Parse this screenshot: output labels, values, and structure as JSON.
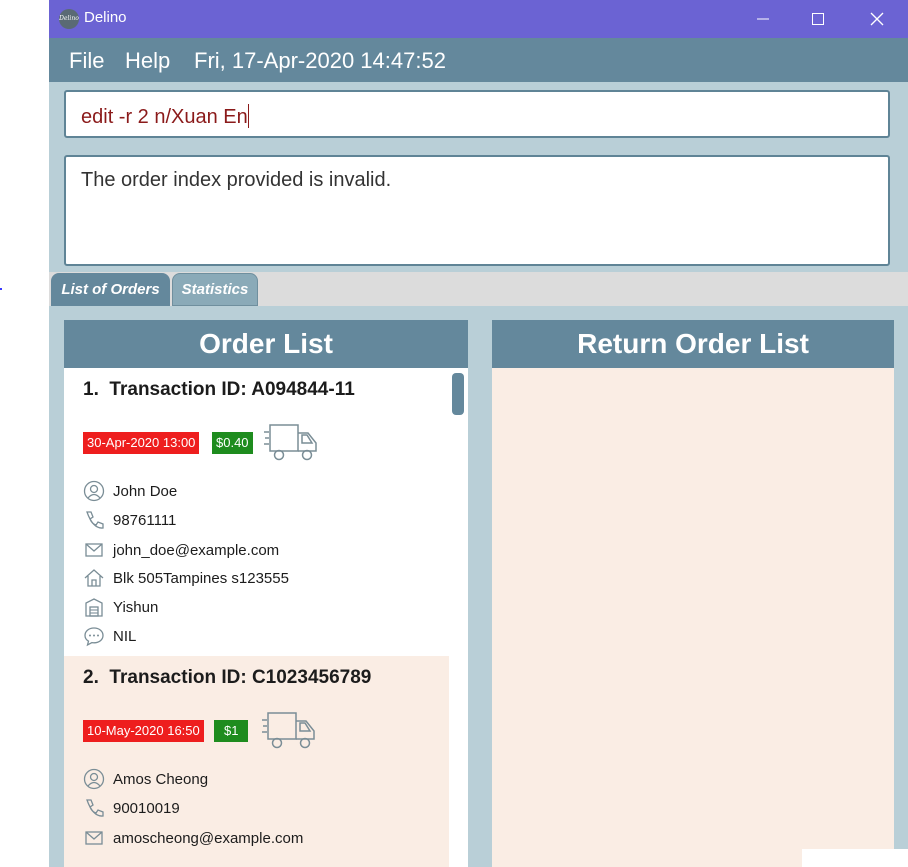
{
  "window": {
    "title": "Delino",
    "icon_text": "Delino"
  },
  "menu": {
    "file": "File",
    "help": "Help",
    "datetime": "Fri, 17-Apr-2020 14:47:52"
  },
  "command": {
    "value": "edit -r 2 n/Xuan En"
  },
  "result": {
    "message": "The order index provided is invalid."
  },
  "tabs": [
    {
      "label": "List of Orders",
      "selected": true
    },
    {
      "label": "Statistics",
      "selected": false
    }
  ],
  "order_panel": {
    "title": "Order List"
  },
  "return_panel": {
    "title": "Return Order List"
  },
  "orders": [
    {
      "index": "1.",
      "transaction": "Transaction ID: A094844-11",
      "date": "30-Apr-2020 13:00",
      "cash": "$0.40",
      "name": "John Doe",
      "phone": "98761111",
      "email": "john_doe@example.com",
      "address": "Blk 505Tampines  s123555",
      "warehouse": "Yishun",
      "comment": "NIL"
    },
    {
      "index": "2.",
      "transaction": "Transaction ID: C1023456789",
      "date": "10-May-2020 16:50",
      "cash": "$1",
      "name": "Amos Cheong",
      "phone": "90010019",
      "email": "amoscheong@example.com"
    }
  ],
  "colors": {
    "titlebar": "#6b63d3",
    "menubar": "#64889c",
    "background": "#b9cfd7",
    "date_tag": "#ee1e1e",
    "cash_tag": "#1e8c1e",
    "return_panel": "#faede4",
    "command_text": "#8b1a1a"
  }
}
